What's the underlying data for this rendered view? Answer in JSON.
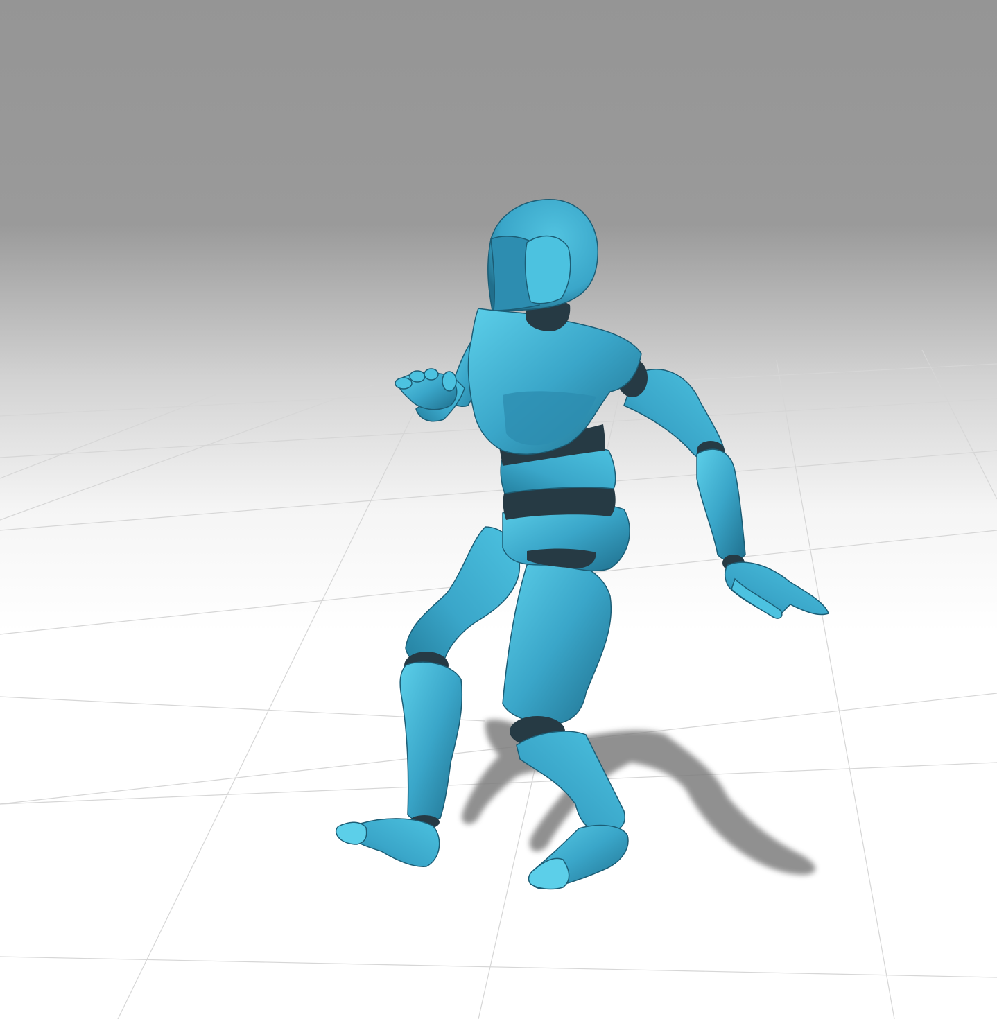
{
  "scene": {
    "subject": "mannequin-figure",
    "colors": {
      "backdrop_top": "#959595",
      "backdrop_horizon": "#d8d8d8",
      "floor": "#ffffff",
      "grid_line": "#d6d6d6",
      "body_main": "#3aa6c9",
      "body_light": "#5ccfe9",
      "body_dark": "#1f6f8d",
      "joint": "#263a44",
      "shadow": "#7d7d7d"
    }
  }
}
